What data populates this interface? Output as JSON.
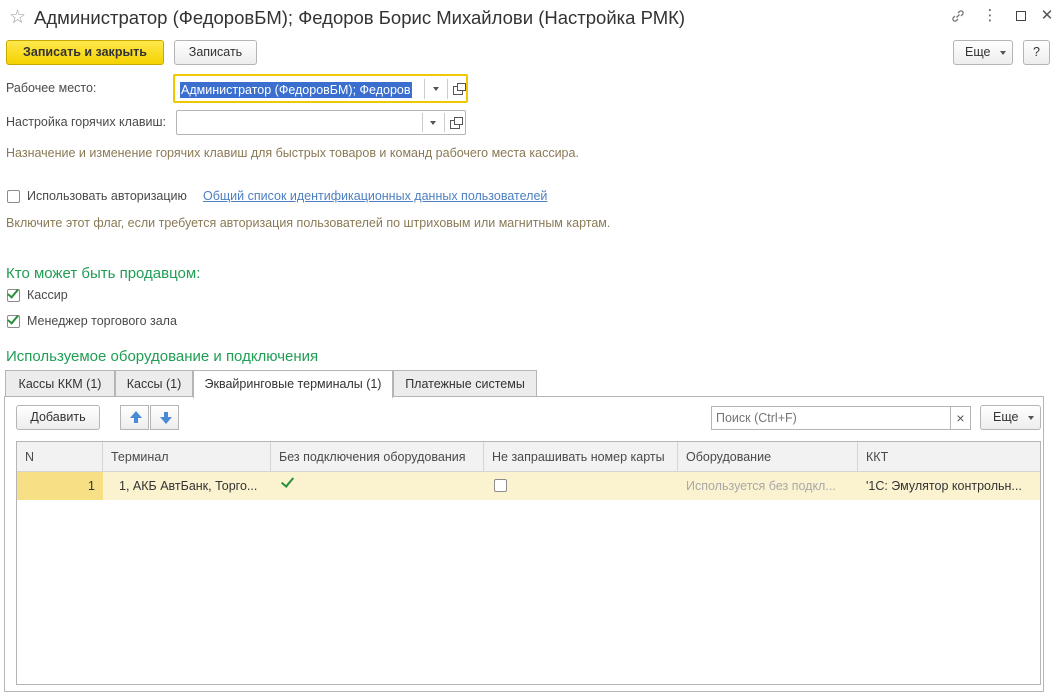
{
  "window": {
    "title": "Администратор (ФедоровБМ); Федоров Борис Михайлови (Настройка РМК)"
  },
  "toolbar": {
    "save_close_label": "Записать и закрыть",
    "save_label": "Записать",
    "more_label": "Еще",
    "help_label": "?"
  },
  "form": {
    "workplace_label": "Рабочее место:",
    "workplace_value": "Администратор (ФедоровБМ); Федоров",
    "hotkeys_label": "Настройка горячих клавиш:",
    "hotkeys_value": "",
    "hotkeys_hint": "Назначение и изменение горячих клавиш для быстрых товаров и команд рабочего места кассира.",
    "auth_label": "Использовать авторизацию",
    "auth_link": "Общий список идентификационных данных пользователей",
    "auth_hint": "Включите этот флаг, если требуется авторизация пользователей по штриховым или магнитным картам."
  },
  "sellers": {
    "title": "Кто может быть продавцом:",
    "items": [
      {
        "label": "Кассир",
        "checked": true
      },
      {
        "label": "Менеджер торгового зала",
        "checked": true
      }
    ]
  },
  "equipment": {
    "title": "Используемое оборудование и подключения",
    "tabs": [
      {
        "label": "Кассы ККМ (1)",
        "active": false
      },
      {
        "label": "Кассы (1)",
        "active": false
      },
      {
        "label": "Эквайринговые терминалы (1)",
        "active": true
      },
      {
        "label": "Платежные системы",
        "active": false
      }
    ],
    "add_label": "Добавить",
    "search_placeholder": "Поиск (Ctrl+F)",
    "clear_label": "×",
    "more_label": "Еще",
    "table": {
      "columns": [
        "N",
        "Терминал",
        "Без подключения оборудования",
        "Не запрашивать номер карты",
        "Оборудование",
        "ККТ"
      ],
      "rows": [
        {
          "n": "1",
          "terminal": "1, АКБ АвтБанк, Торго...",
          "no_equipment": true,
          "no_card_number": false,
          "equipment": "Используется без подкл...",
          "kkt": "'1С: Эмулятор контрольн..."
        }
      ]
    }
  },
  "colors": {
    "accent_green": "#1f9e54",
    "primary_yellow": "#f5d200",
    "link_blue": "#4d7fc1",
    "selected_row": "#fbf3d0"
  }
}
